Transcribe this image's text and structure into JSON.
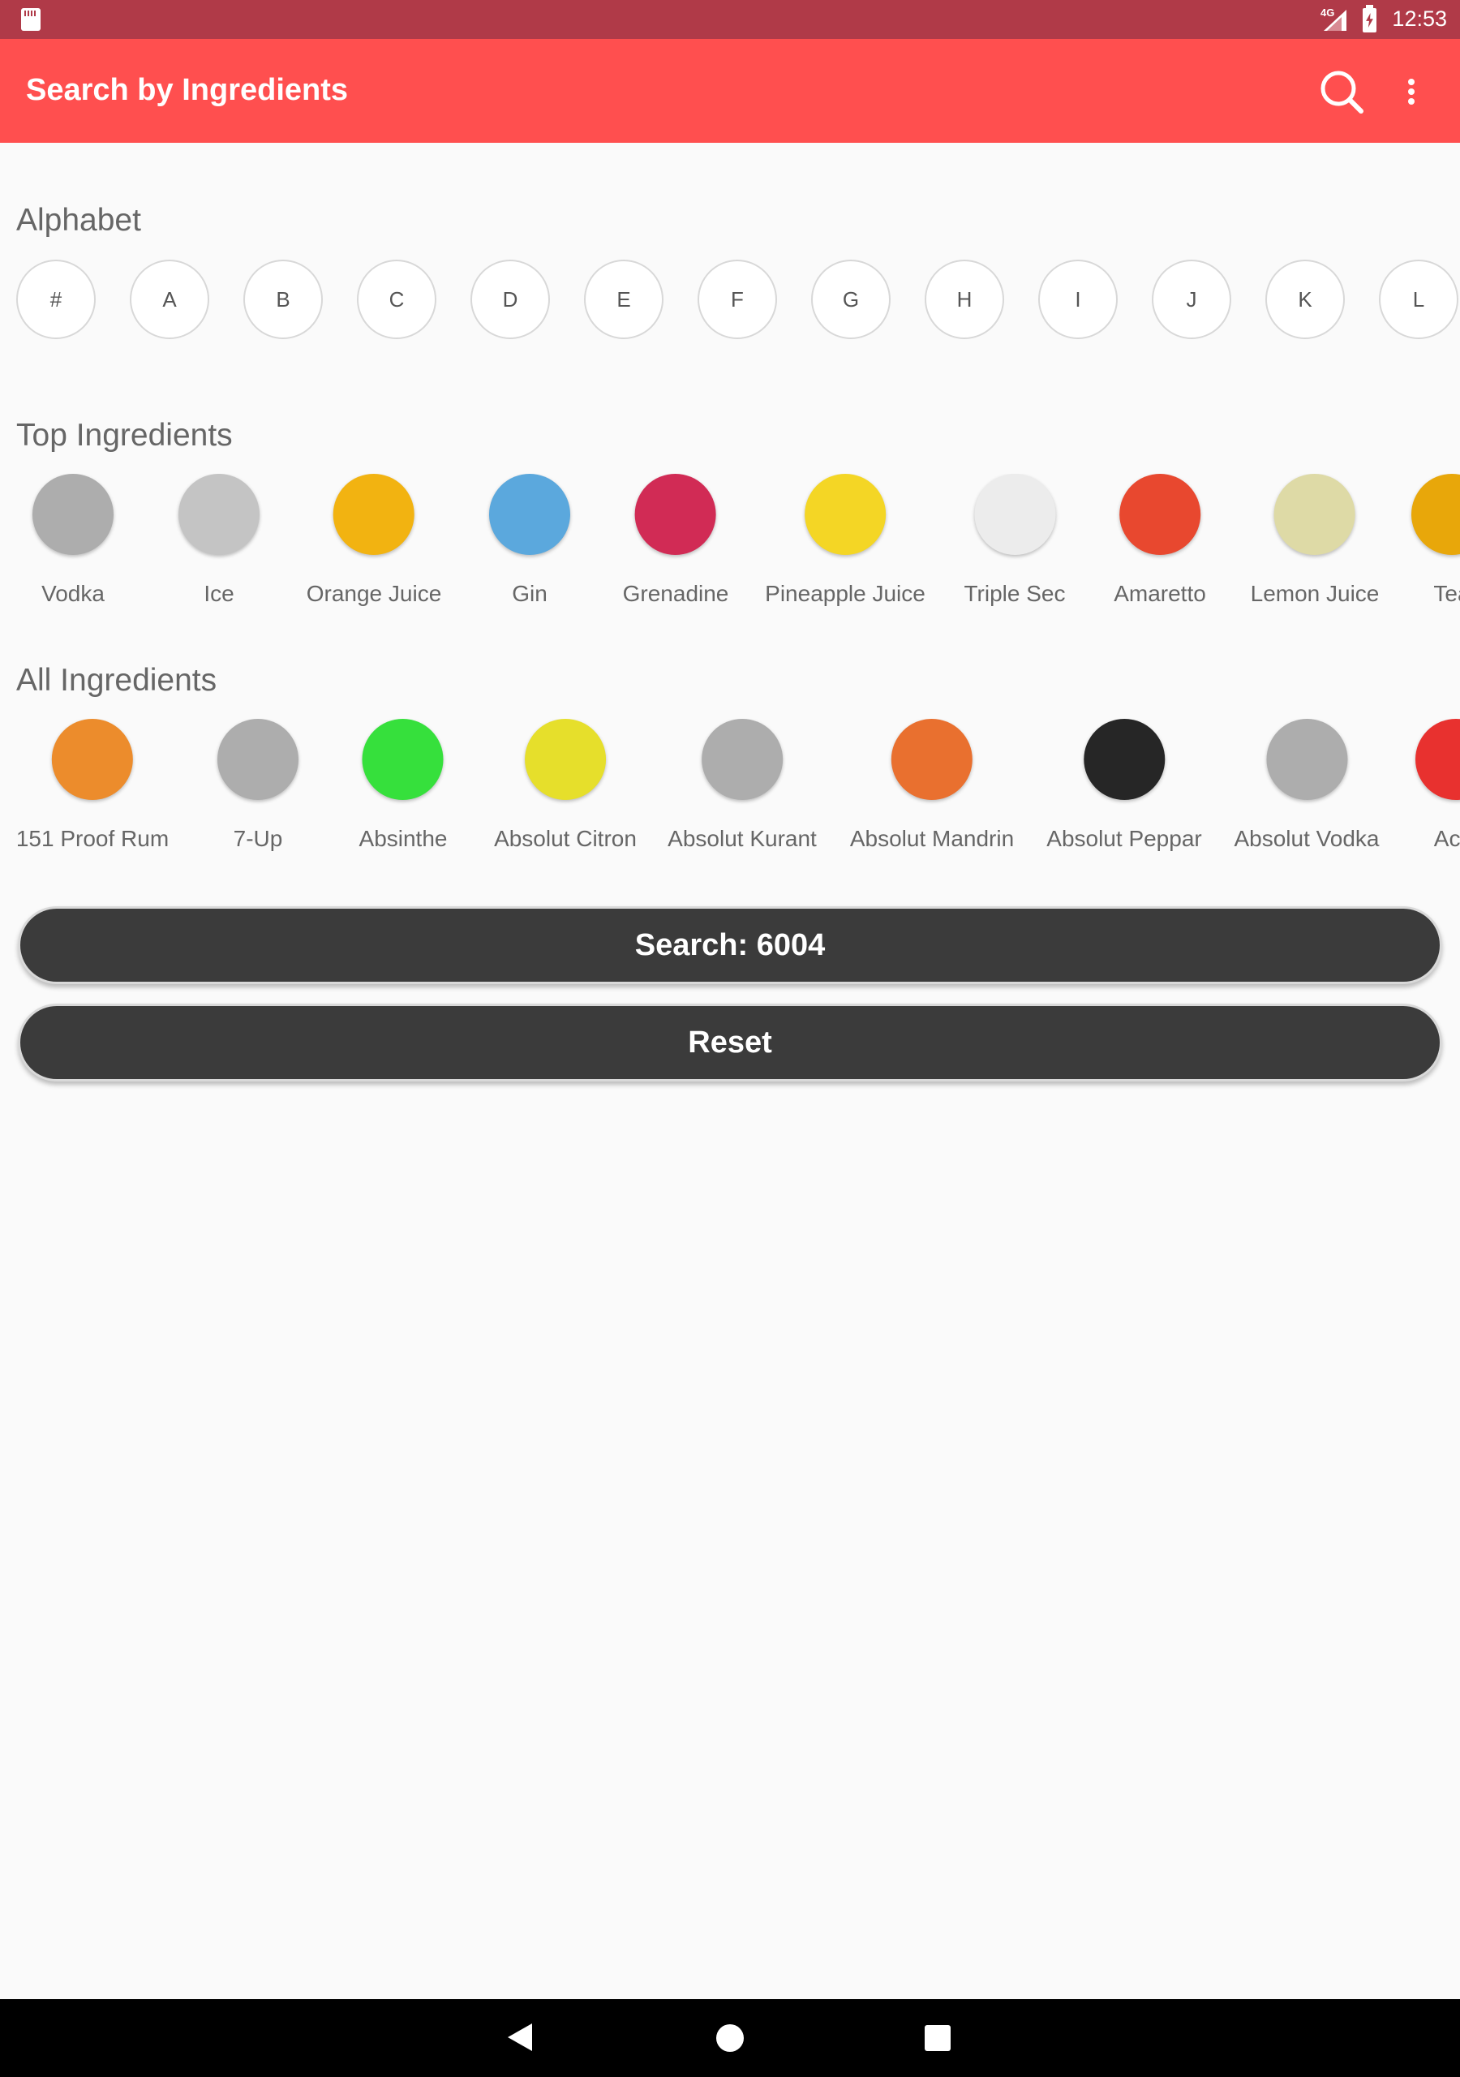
{
  "status_bar": {
    "network": "4G",
    "time": "12:53"
  },
  "app_bar": {
    "title": "Search by Ingredients"
  },
  "sections": {
    "alphabet": "Alphabet",
    "top": "Top Ingredients",
    "all": "All Ingredients"
  },
  "alphabet": [
    "#",
    "A",
    "B",
    "C",
    "D",
    "E",
    "F",
    "G",
    "H",
    "I",
    "J",
    "K",
    "L"
  ],
  "top_ingredients": [
    {
      "name": "Vodka",
      "color": "#adadad"
    },
    {
      "name": "Ice",
      "color": "#c4c4c4"
    },
    {
      "name": "Orange Juice",
      "color": "#f2b311"
    },
    {
      "name": "Gin",
      "color": "#5ba8dd"
    },
    {
      "name": "Grenadine",
      "color": "#d12b55"
    },
    {
      "name": "Pineapple Juice",
      "color": "#f4d625"
    },
    {
      "name": "Triple Sec",
      "color": "#ececec"
    },
    {
      "name": "Amaretto",
      "color": "#e8482f"
    },
    {
      "name": "Lemon Juice",
      "color": "#dedaa6"
    },
    {
      "name": "Tea",
      "color": "#e8a70a"
    }
  ],
  "all_ingredients": [
    {
      "name": "151 Proof Rum",
      "color": "#ec8c2c"
    },
    {
      "name": "7-Up",
      "color": "#adadad"
    },
    {
      "name": "Absinthe",
      "color": "#36e03c"
    },
    {
      "name": "Absolut Citron",
      "color": "#e6df2b"
    },
    {
      "name": "Absolut Kurant",
      "color": "#adadad"
    },
    {
      "name": "Absolut Mandrin",
      "color": "#e9702f"
    },
    {
      "name": "Absolut Peppar",
      "color": "#262626"
    },
    {
      "name": "Absolut Vodka",
      "color": "#adadad"
    },
    {
      "name": "Acid",
      "color": "#e8312f"
    }
  ],
  "buttons": {
    "search": "Search: 6004",
    "reset": "Reset"
  }
}
